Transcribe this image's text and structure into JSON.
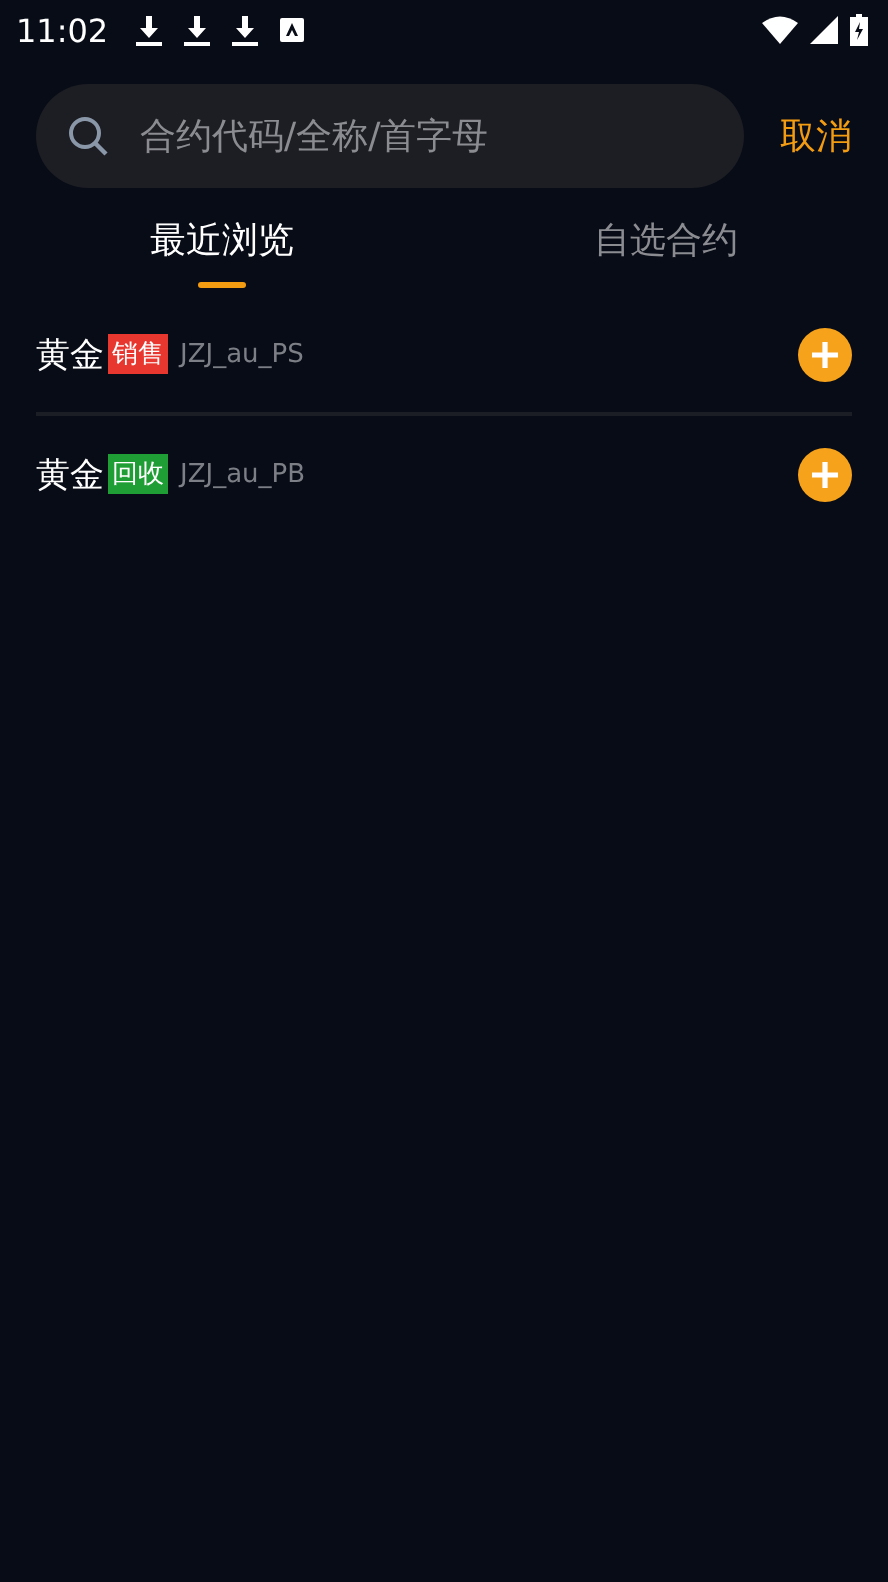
{
  "status_bar": {
    "time": "11:02"
  },
  "search": {
    "placeholder": "合约代码/全称/首字母",
    "cancel": "取消"
  },
  "tabs": [
    {
      "label": "最近浏览",
      "selected": true
    },
    {
      "label": "自选合约",
      "selected": false
    }
  ],
  "items": [
    {
      "name": "黄金",
      "tag": "销售",
      "color": "#e8372e",
      "code": "JZJ_au_PS"
    },
    {
      "name": "黄金",
      "tag": "回收",
      "color": "#1e9e35",
      "code": "JZJ_au_PB"
    }
  ]
}
